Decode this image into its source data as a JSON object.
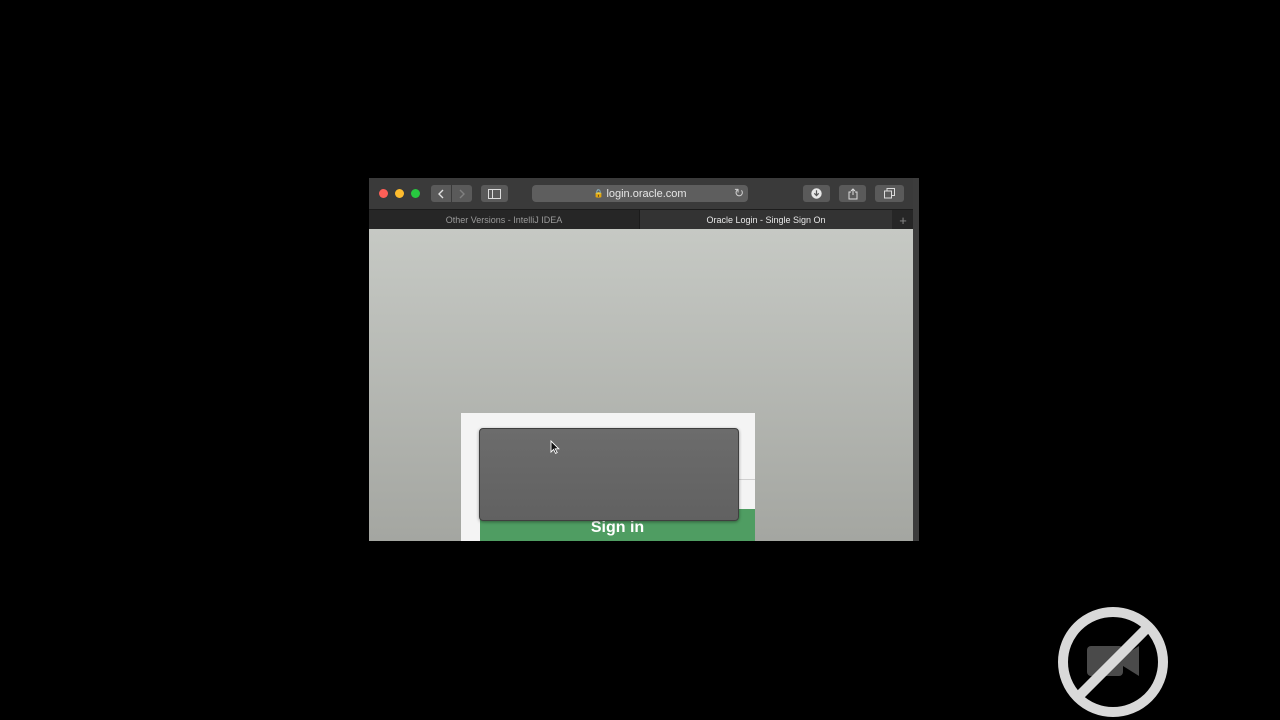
{
  "browser": {
    "address": "login.oracle.com",
    "icons": {
      "back": "chevron-left-icon",
      "forward": "chevron-right-icon",
      "sidebar": "sidebar-icon",
      "lock": "lock-icon",
      "reload": "reload-icon",
      "download": "download-icon",
      "share": "share-icon",
      "tabs": "tabs-overview-icon",
      "new_tab": "plus-icon"
    },
    "tabs": [
      {
        "label": "Other Versions - IntelliJ IDEA",
        "active": false
      },
      {
        "label": "Oracle Login - Single Sign On",
        "active": true
      }
    ]
  },
  "page": {
    "signin_label": "Sign in"
  },
  "colors": {
    "signin_green": "#4f9d62",
    "window_chrome": "#3a3a3a"
  },
  "overlay": {
    "watermark_icon": "no-camera-icon"
  }
}
